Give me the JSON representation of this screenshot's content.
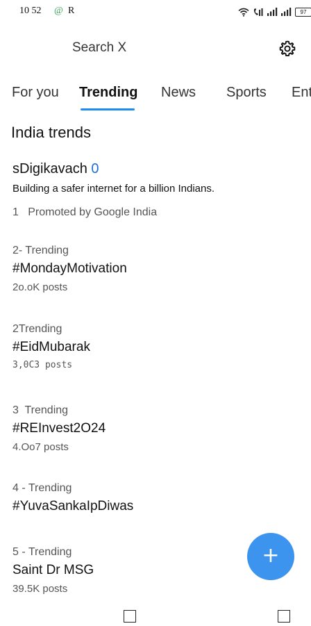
{
  "status_bar": {
    "time": "10 52",
    "at_symbol": "@",
    "r_symbol": "R",
    "battery": "97"
  },
  "header": {
    "search_label": "Search X"
  },
  "tabs": [
    {
      "label": "For you"
    },
    {
      "label": "Trending"
    },
    {
      "label": "News"
    },
    {
      "label": "Sports"
    },
    {
      "label": "Enter"
    }
  ],
  "section": {
    "title": "India trends"
  },
  "promoted": {
    "title_prefix": "sDigikavach",
    "title_suffix": "0",
    "description": "Building a safer internet for a billion Indians.",
    "meta": "1   Promoted by Google India"
  },
  "trends": [
    {
      "meta": "2- Trending",
      "title": "#MondayMotivation",
      "count": "2o.oK posts"
    },
    {
      "meta": "2Trending",
      "title": "#EidMubarak",
      "count": "3,0C3 posts"
    },
    {
      "meta": "3  Trending",
      "title": "#REInvest2O24",
      "count": "4.Oo7 posts"
    },
    {
      "meta": "4 - Trending",
      "title": "#YuvaSankaIpDiwas",
      "count": ""
    },
    {
      "meta": "5 - Trending",
      "title": "Saint Dr MSG",
      "count": "39.5K posts"
    }
  ],
  "fab": {
    "symbol": "+"
  },
  "icons": {
    "wifi": "wifi-icon",
    "call": "wifi-call-icon",
    "signal": "signal-icon",
    "gear": "gear-icon"
  },
  "colors": {
    "accent": "#1d8bf0",
    "fab": "#3d94ef"
  }
}
